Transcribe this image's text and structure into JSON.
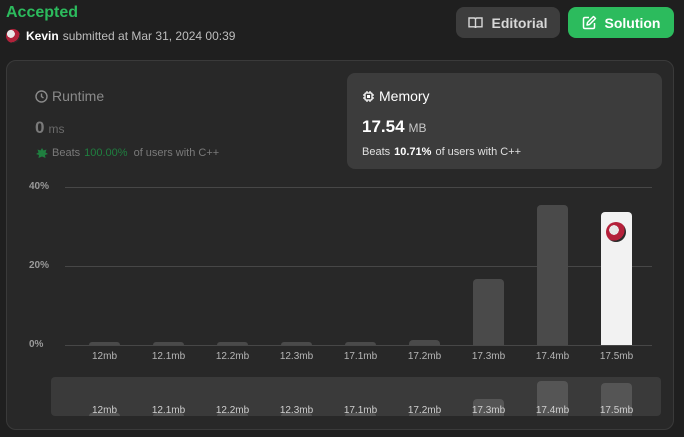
{
  "header": {
    "status": "Accepted",
    "username": "Kevin",
    "submitted_text": "submitted at Mar 31, 2024 00:39",
    "editorial_label": "Editorial",
    "solution_label": "Solution"
  },
  "runtime": {
    "label": "Runtime",
    "value": "0",
    "unit": "ms",
    "beats_label": "Beats",
    "beats_pct": "100.00%",
    "beats_suffix": "of users with C++"
  },
  "memory": {
    "label": "Memory",
    "value": "17.54",
    "unit": "MB",
    "beats_label": "Beats",
    "beats_pct": "10.71%",
    "beats_suffix": "of users with C++"
  },
  "colors": {
    "accepted": "#2cbb5d",
    "solution_button": "#2cbb5d",
    "bar": "#4a4a4a",
    "bar_selected": "#f2f2f2"
  },
  "chart_data": {
    "type": "bar",
    "categories": [
      "12mb",
      "12.1mb",
      "12.2mb",
      "12.3mb",
      "17.1mb",
      "17.2mb",
      "17.3mb",
      "17.4mb",
      "17.5mb"
    ],
    "values": [
      0.8,
      0.8,
      0.8,
      0.8,
      0.8,
      1.3,
      16.8,
      35.4,
      33.6
    ],
    "selected_category": "17.5mb",
    "y_ticks": [
      "0%",
      "20%",
      "40%"
    ],
    "ylim": [
      0,
      40
    ],
    "grid": true
  }
}
